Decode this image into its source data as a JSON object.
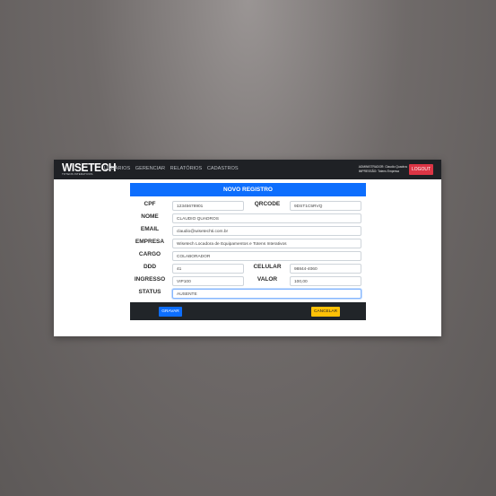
{
  "brand": {
    "name": "WISETECH",
    "tagline": "TOTENS INTERATIVOS"
  },
  "nav": {
    "items": [
      "USUÁRIOS",
      "GERENCIAR",
      "RELATÓRIOS",
      "CADASTROS"
    ]
  },
  "user": {
    "line1": "ADMINISTRADOR: Claudio Quadros",
    "line2": "IMPRESSÃO: Totens Empresa",
    "logout_label": "LOGOUT"
  },
  "form": {
    "title": "NOVO REGISTRO",
    "labels": {
      "cpf": "CPF",
      "qrcode": "QRCODE",
      "nome": "NOME",
      "email": "EMAIL",
      "empresa": "EMPRESA",
      "cargo": "CARGO",
      "ddd": "DDD",
      "celular": "CELULAR",
      "ingresso": "INGRESSO",
      "valor": "VALOR",
      "status": "STATUS"
    },
    "values": {
      "cpf": "12345678901",
      "qrcode": "9DST1C5RVQ",
      "nome": "CLAUDIO QUADROS",
      "email": "claudio@wisetechti.com.br",
      "empresa": "Wisetech Locadora de Equipamentos e Totens Interativos",
      "cargo": "COLABORADOR",
      "ddd": "41",
      "celular": "98844-4060",
      "ingresso": "VIP100",
      "valor": "100,00",
      "status": "AUSENTE"
    },
    "save_label": "GRAVAR",
    "cancel_label": "CANCELAR"
  },
  "colors": {
    "primary": "#0d6efd",
    "navbar": "#1f2125",
    "danger": "#dc3545",
    "warning": "#ffc107"
  }
}
